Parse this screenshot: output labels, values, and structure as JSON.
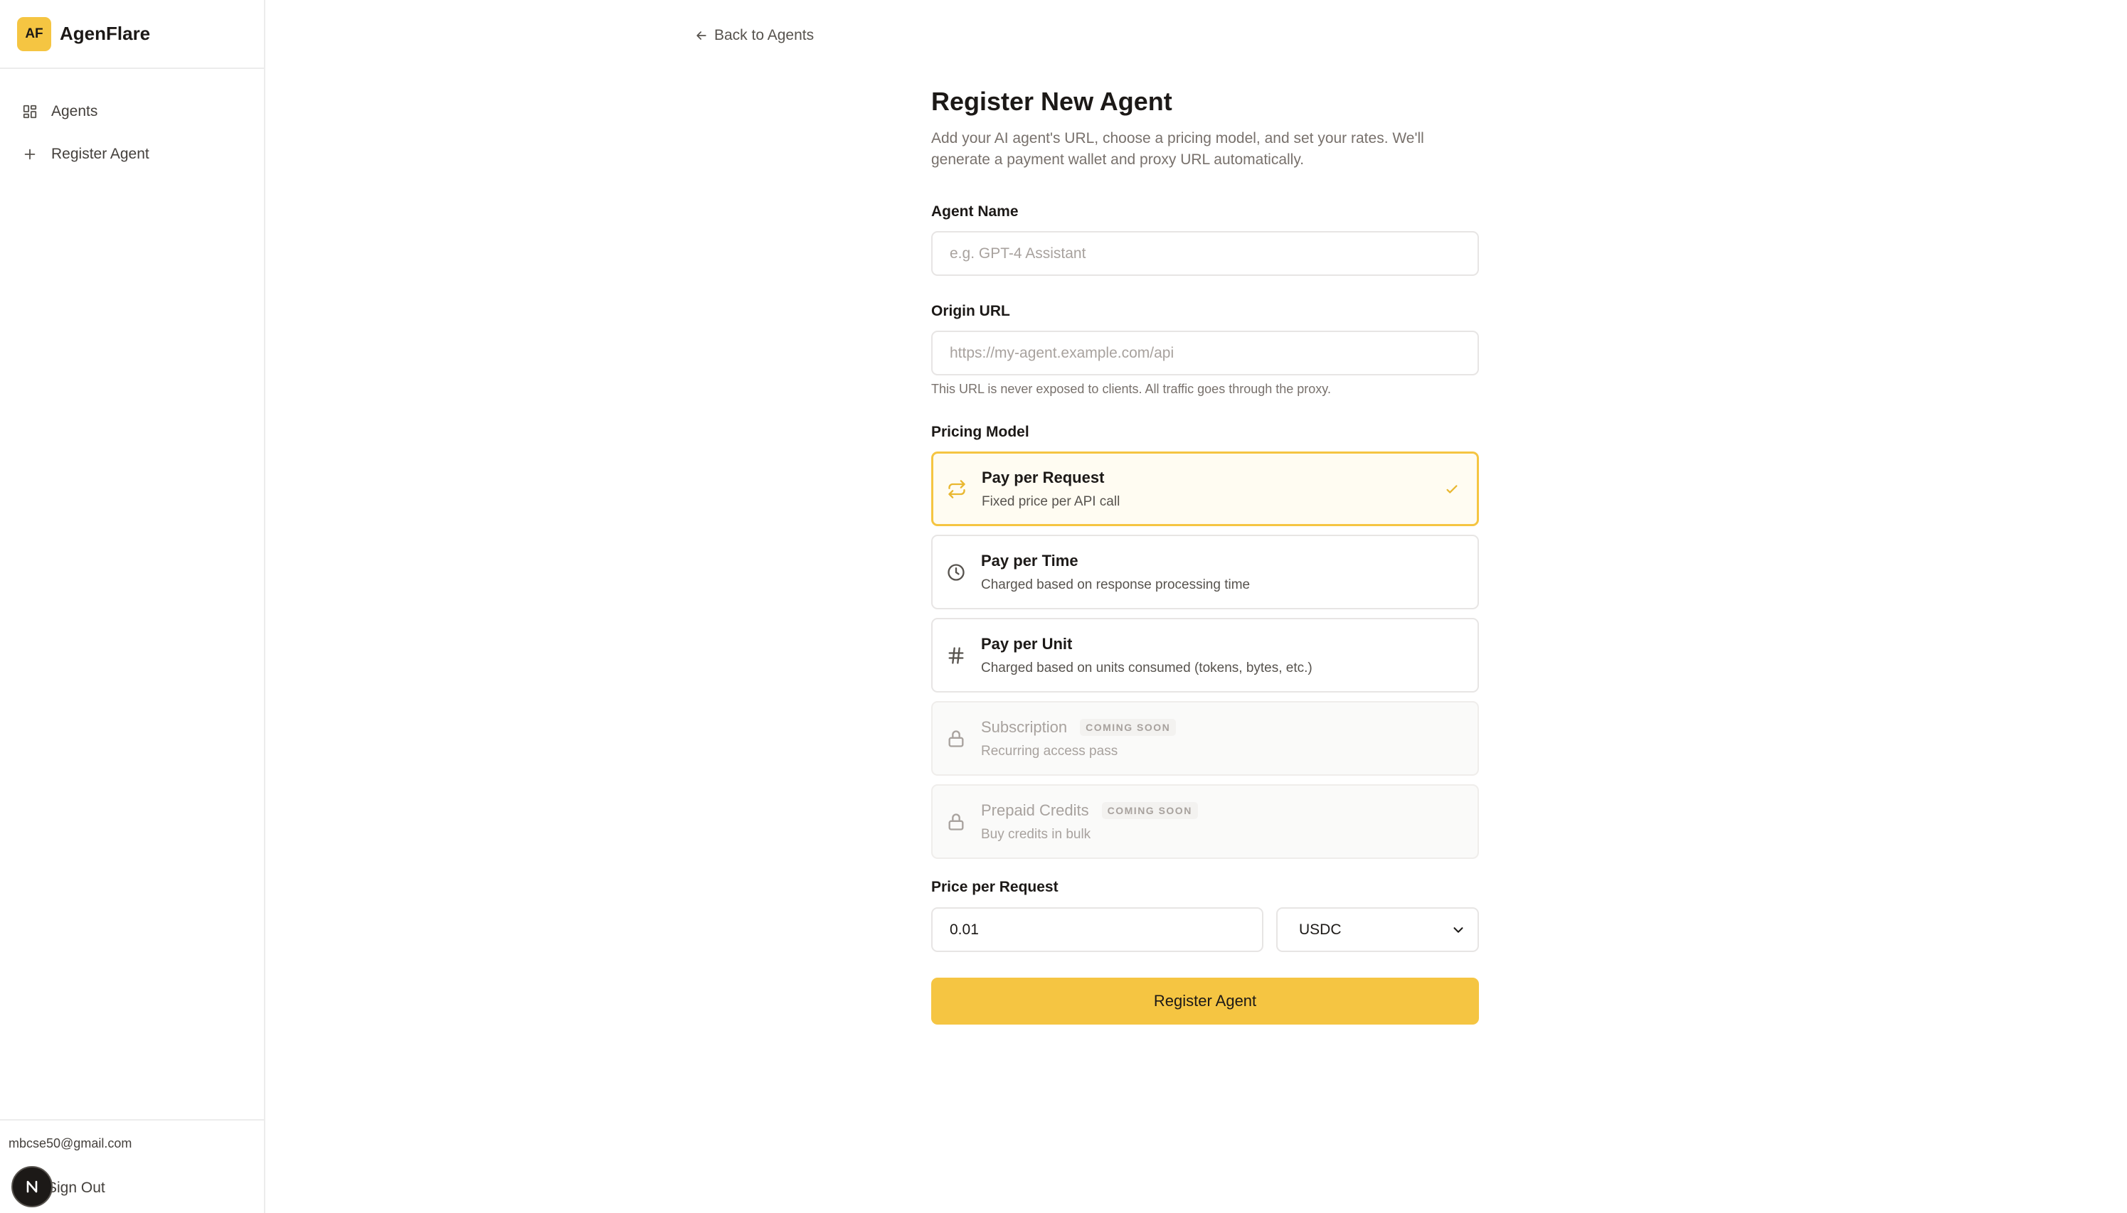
{
  "brand": {
    "logo_text": "AF",
    "name": "AgenFlare",
    "accent": "#f5c542"
  },
  "sidebar": {
    "items": [
      {
        "label": "Agents",
        "icon": "grid-icon"
      },
      {
        "label": "Register Agent",
        "icon": "plus-icon"
      }
    ],
    "user_email": "mbcse50@gmail.com",
    "sign_out_label": "Sign Out",
    "avatar_letter": "N"
  },
  "main": {
    "back_label": "Back to Agents",
    "title": "Register New Agent",
    "description": "Add your AI agent's URL, choose a pricing model, and set your rates. We'll generate a payment wallet and proxy URL automatically.",
    "agent_name": {
      "label": "Agent Name",
      "placeholder": "e.g. GPT-4 Assistant",
      "value": ""
    },
    "origin_url": {
      "label": "Origin URL",
      "placeholder": "https://my-agent.example.com/api",
      "value": "",
      "hint": "This URL is never exposed to clients. All traffic goes through the proxy."
    },
    "pricing_model": {
      "label": "Pricing Model",
      "selected": "Pay per Request",
      "options": [
        {
          "title": "Pay per Request",
          "desc": "Fixed price per API call",
          "icon": "repeat-arrows-icon",
          "state": "selected"
        },
        {
          "title": "Pay per Time",
          "desc": "Charged based on response processing time",
          "icon": "clock-icon",
          "state": "available"
        },
        {
          "title": "Pay per Unit",
          "desc": "Charged based on units consumed (tokens, bytes, etc.)",
          "icon": "hash-icon",
          "state": "available"
        },
        {
          "title": "Subscription",
          "desc": "Recurring access pass",
          "icon": "lock-icon",
          "state": "disabled",
          "badge": "COMING SOON"
        },
        {
          "title": "Prepaid Credits",
          "desc": "Buy credits in bulk",
          "icon": "lock-icon",
          "state": "disabled",
          "badge": "COMING SOON"
        }
      ]
    },
    "price": {
      "label": "Price per Request",
      "value": "0.01",
      "currency": "USDC"
    },
    "submit_label": "Register Agent"
  }
}
